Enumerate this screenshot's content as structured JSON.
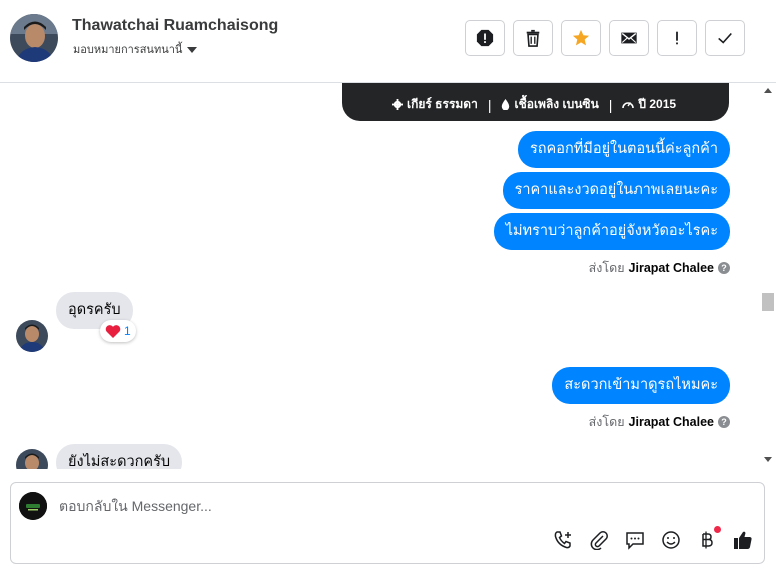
{
  "header": {
    "contact_name": "Thawatchai Ruamchaisong",
    "assign_label": "มอบหมายการสนทนานี้",
    "actions": [
      {
        "name": "mark-spam-button",
        "icon": "alert-octagon-icon"
      },
      {
        "name": "delete-button",
        "icon": "trash-icon"
      },
      {
        "name": "star-button",
        "icon": "star-icon",
        "color": "#f5a623"
      },
      {
        "name": "mark-unread-button",
        "icon": "envelope-icon"
      },
      {
        "name": "important-button",
        "icon": "exclamation-icon"
      },
      {
        "name": "done-button",
        "icon": "check-icon"
      }
    ]
  },
  "car_card": {
    "gear": "เกียร์ ธรรมดา",
    "fuel": "เชื้อเพลิง เบนซิน",
    "year": "ปี 2015"
  },
  "messages": {
    "out_1": "รถคอกที่มีอยู่ในตอนนี้ค่ะลูกค้า",
    "out_2": "ราคาและงวดอยู่ในภาพเลยนะคะ",
    "out_3": "ไม่ทราบว่าลูกค้าอยู่จังหวัดอะไรคะ",
    "sent_by_1_prefix": "ส่งโดย",
    "sent_by_1_name": "Jirapat Chalee",
    "in_1": "อุดรครับ",
    "in_1_reaction_count": "1",
    "out_4": "สะดวกเข้ามาดูรถไหมคะ",
    "sent_by_2_prefix": "ส่งโดย",
    "sent_by_2_name": "Jirapat Chalee",
    "in_2": "ยังไม่สะดวกครับ"
  },
  "composer": {
    "placeholder": "ตอบกลับใน Messenger..."
  },
  "colors": {
    "outgoing": "#0084ff",
    "incoming": "#e4e6eb",
    "star": "#f5a623"
  }
}
